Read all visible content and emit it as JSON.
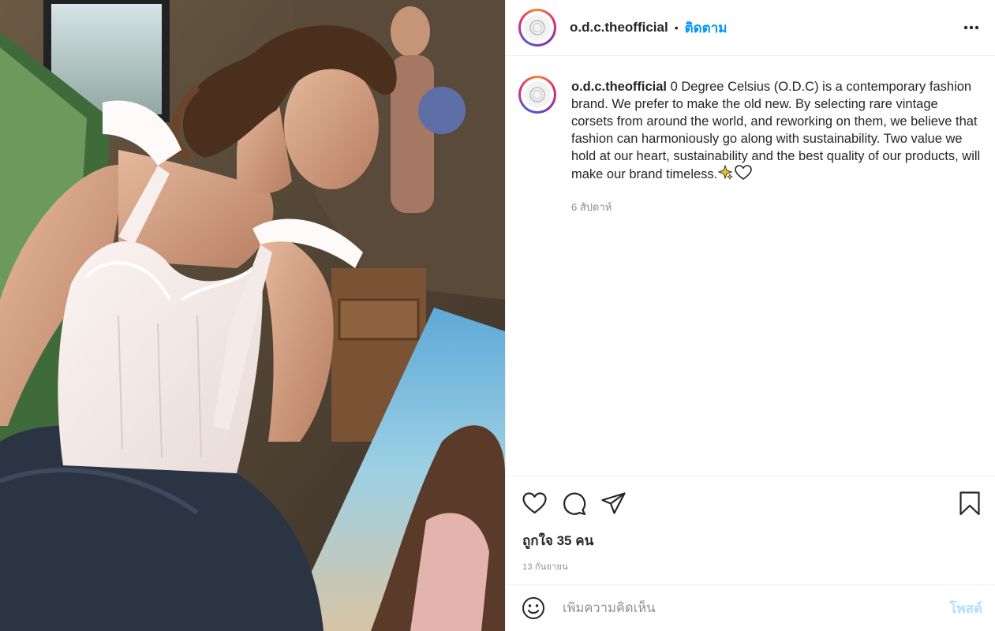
{
  "photo": {
    "description_icon": "fashion-photo",
    "colors": {
      "corset": "#f3e9e6",
      "jeans": "#2a3442",
      "skin": "#d9a98b",
      "hair": "#5a3a24",
      "sky_painting": "#7fb5d6"
    }
  },
  "header": {
    "username": "o.d.c.theofficial",
    "separator": "•",
    "follow_label": "ติดตาม",
    "more_icon": "more-horizontal-icon"
  },
  "caption": {
    "username": "o.d.c.theofficial",
    "text": "0 Degree Celsius (O.D.C) is a contemporary fashion brand. We prefer to make the old new. By selecting rare vintage corsets from around the world, and reworking on them, we believe that fashion can harmoniously go along with sustainability. Two value we hold at our heart, sustainability and the best quality of our products, will make our brand timeless.",
    "emojis": [
      "sparkles-icon",
      "white-heart-icon"
    ],
    "time": "6 สัปดาห์"
  },
  "actions": {
    "icons": [
      "heart-icon",
      "comment-icon",
      "share-icon",
      "bookmark-icon"
    ],
    "likes": "ถูกใจ 35 คน",
    "date": "13 กันยายน"
  },
  "comment": {
    "placeholder": "เพิ่มความคิดเห็น",
    "post_label": "โพสต์"
  },
  "colors": {
    "accent": "#0095f6",
    "post_disabled": "#b2dffc",
    "text": "#262626",
    "muted": "#8e8e8e",
    "border": "#efefef"
  }
}
